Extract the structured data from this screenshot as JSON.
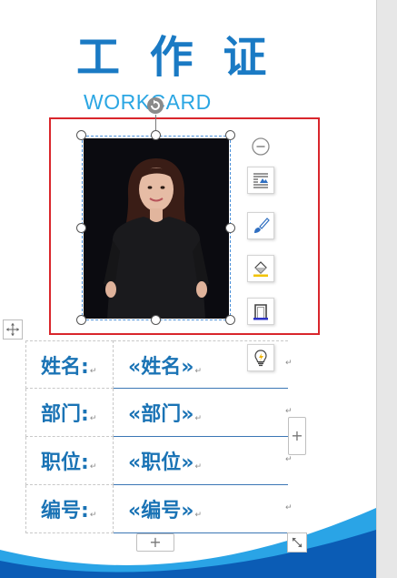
{
  "card": {
    "title_cn": "工 作 证",
    "title_en": "WORKCARD"
  },
  "fields": [
    {
      "label": "姓名:",
      "value": "«姓名»"
    },
    {
      "label": "部门:",
      "value": "«部门»"
    },
    {
      "label": "职位:",
      "value": "«职位»"
    },
    {
      "label": "编号:",
      "value": "«编号»"
    }
  ],
  "controls": {
    "add_column": "+",
    "add_row": "+"
  },
  "colors": {
    "title_blue": "#1a7ac4",
    "subtitle_blue": "#2ba6e3",
    "field_blue": "#1a73b5",
    "selection_red": "#d9262c",
    "wave_dark": "#0b5cb5",
    "wave_light": "#2aa4e6"
  },
  "icons": {
    "collapse": "minus-circle-icon",
    "layout": "layout-options-icon",
    "brush": "brush-icon",
    "fill": "fill-color-icon",
    "border": "border-icon",
    "idea": "lightbulb-icon",
    "rotate": "rotate-handle-icon",
    "move": "move-icon",
    "resize": "resize-icon"
  }
}
